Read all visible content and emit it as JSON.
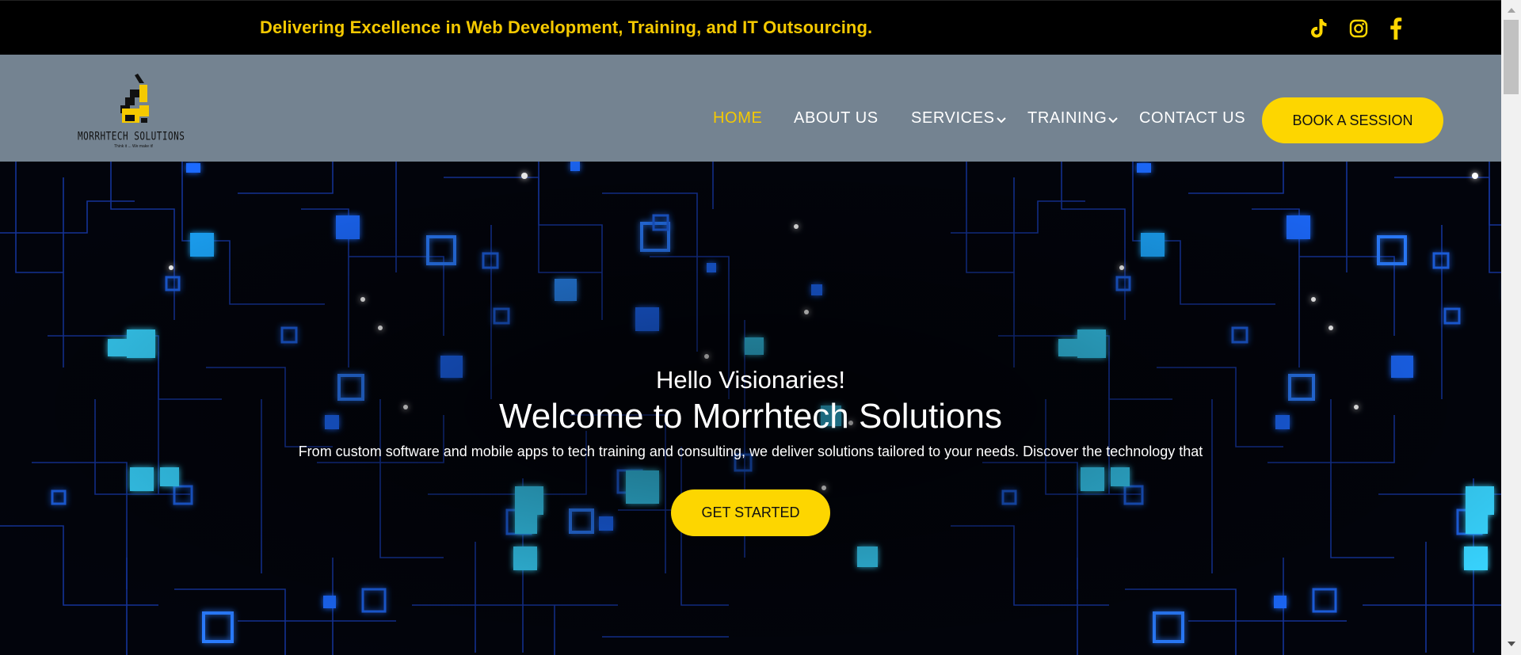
{
  "topbar": {
    "tagline": "Delivering Excellence in Web Development, Training, and IT Outsourcing.",
    "social": [
      {
        "icon": "tiktok-icon"
      },
      {
        "icon": "instagram-icon"
      },
      {
        "icon": "facebook-icon"
      }
    ]
  },
  "brand": {
    "name": "MORRHTECH SOLUTIONS",
    "slogan": "Think it ... We make it!"
  },
  "nav": {
    "items": [
      {
        "label": "HOME",
        "active": true
      },
      {
        "label": "ABOUT US"
      },
      {
        "label": "SERVICES",
        "dropdown": true
      },
      {
        "label": "TRAINING",
        "dropdown": true
      },
      {
        "label": "CONTACT US"
      }
    ],
    "cta": "BOOK A SESSION"
  },
  "hero": {
    "greeting": "Hello Visionaries!",
    "title": "Welcome to Morrhtech Solutions",
    "description": "From custom software and mobile apps to tech training and consulting, we deliver solutions tailored to your needs. Discover the technology that",
    "cta": "GET STARTED"
  },
  "colors": {
    "accent": "#fdd600",
    "tagline": "#f5c900",
    "nav_bg": "#748391",
    "topbar_bg": "#000000",
    "circuit": "#1e6bff"
  }
}
